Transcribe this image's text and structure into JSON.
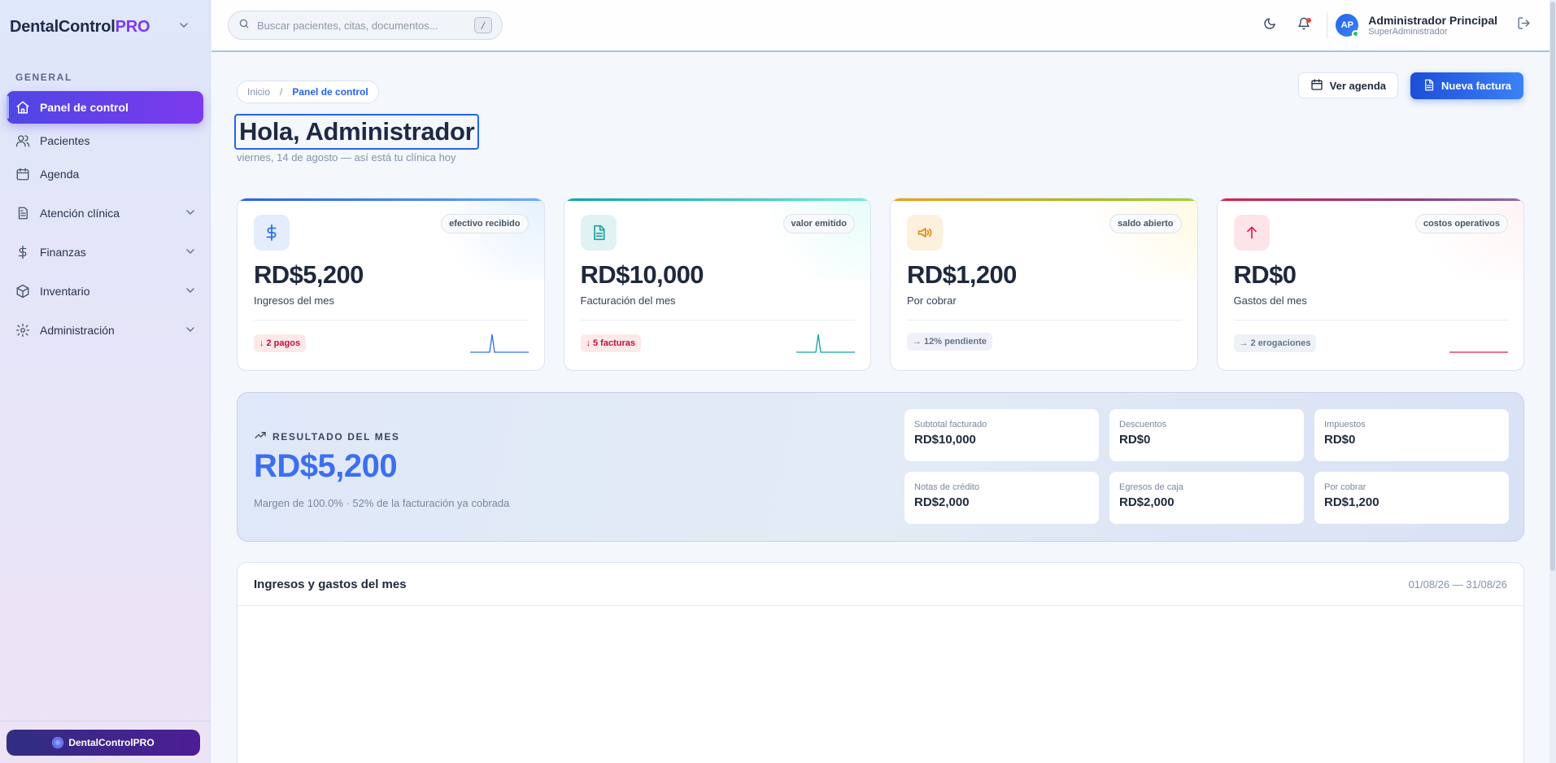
{
  "sidebar": {
    "brand": {
      "main": "DentalControl",
      "accent": "PRO"
    },
    "section": "GENERAL",
    "items": [
      {
        "label": "Panel de control",
        "icon": "home-icon",
        "active": true
      },
      {
        "label": "Pacientes",
        "icon": "users-icon"
      },
      {
        "label": "Agenda",
        "icon": "calendar-icon"
      },
      {
        "label": "Atención clínica",
        "icon": "clipboard-icon",
        "expandable": true
      },
      {
        "label": "Finanzas",
        "icon": "dollar-icon",
        "expandable": true
      },
      {
        "label": "Inventario",
        "icon": "box-icon",
        "expandable": true
      },
      {
        "label": "Administración",
        "icon": "gear-icon",
        "expandable": true
      }
    ],
    "footer": "DentalControlPRO"
  },
  "topbar": {
    "search_placeholder": "Buscar pacientes, citas, documentos...",
    "shortcut": "/",
    "user": {
      "initials": "AP",
      "name": "Administrador Principal",
      "role": "SuperAdministrador"
    }
  },
  "page": {
    "breadcrumb": {
      "home": "Inicio",
      "separator": "/",
      "current": "Panel de control"
    },
    "greeting": "Hola, Administrador",
    "subtitle": "viernes, 14 de agosto — así está tu clínica hoy",
    "actions": {
      "agenda": "Ver agenda",
      "invoice": "Nueva factura"
    }
  },
  "kpis": [
    {
      "icon": "dollar-icon",
      "tag": "efectivo recibido",
      "value": "RD$5,200",
      "label": "Ingresos del mes",
      "chip": "2 pagos",
      "chip_arrow": "↓",
      "accent": "#2f6fe4"
    },
    {
      "icon": "document-icon",
      "tag": "valor emitido",
      "value": "RD$10,000",
      "label": "Facturación del mes",
      "chip": "5 facturas",
      "chip_arrow": "↓",
      "accent": "#14a3a3"
    },
    {
      "icon": "megaphone-icon",
      "tag": "saldo abierto",
      "value": "RD$1,200",
      "label": "Por cobrar",
      "chip": "12% pendiente",
      "chip_arrow": "→",
      "accent": "#f59e0b"
    },
    {
      "icon": "arrow-up-icon",
      "tag": "costos operativos",
      "value": "RD$0",
      "label": "Gastos del mes",
      "chip": "2 erogaciones",
      "chip_arrow": "→",
      "accent": "#e11d48"
    }
  ],
  "result": {
    "label": "RESULTADO DEL MES",
    "value": "RD$5,200",
    "desc": "Margen de 100.0% · 52% de la facturación ya cobrada",
    "stats": [
      {
        "label": "Subtotal facturado",
        "value": "RD$10,000"
      },
      {
        "label": "Descuentos",
        "value": "RD$0"
      },
      {
        "label": "Impuestos",
        "value": "RD$0"
      },
      {
        "label": "Notas de crédito",
        "value": "RD$2,000"
      },
      {
        "label": "Egresos de caja",
        "value": "RD$2,000"
      },
      {
        "label": "Por cobrar",
        "value": "RD$1,200"
      }
    ]
  },
  "chart_panel": {
    "title": "Ingresos y gastos del mes",
    "range": "01/08/26 — 31/08/26"
  }
}
